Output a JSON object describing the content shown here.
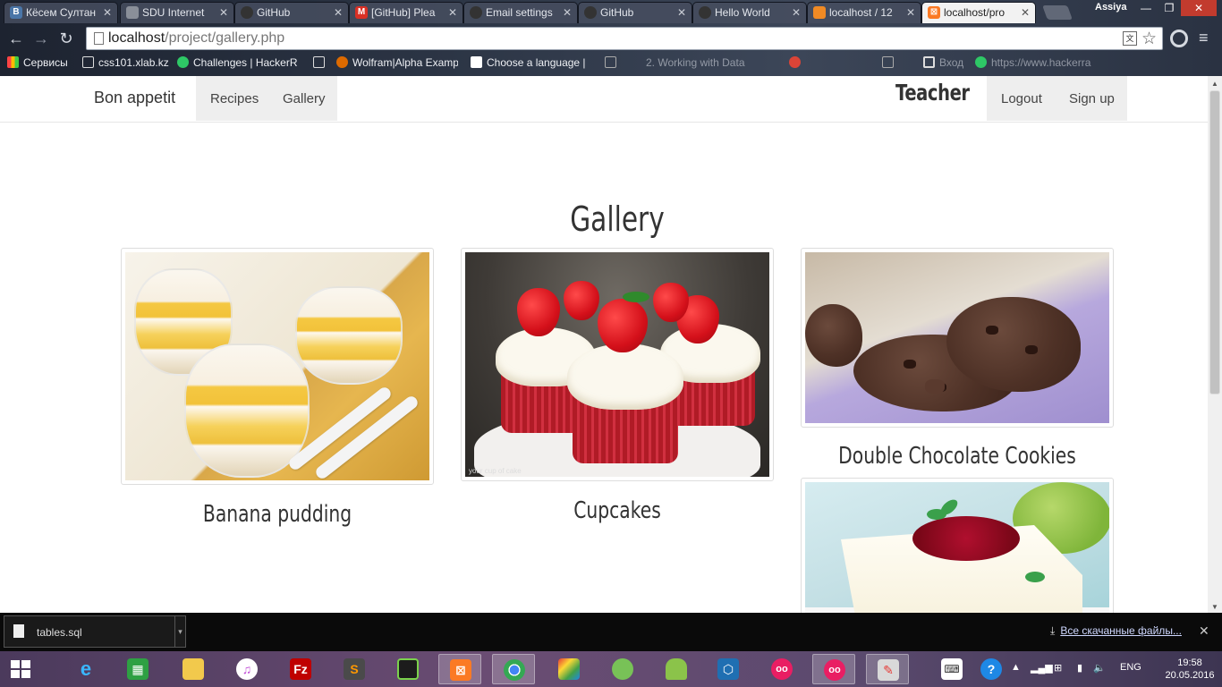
{
  "browser": {
    "tabs": [
      {
        "title": "Кёсем Султан",
        "favicon": "vk-icon",
        "color": "#4a76a8",
        "active": false
      },
      {
        "title": "SDU Internet",
        "favicon": "page-icon",
        "color": "#8a8f99",
        "active": false
      },
      {
        "title": "GitHub",
        "favicon": "github-icon",
        "color": "#333333",
        "active": false
      },
      {
        "title": "[GitHub] Plea",
        "favicon": "gmail-icon",
        "color": "#d93025",
        "active": false
      },
      {
        "title": "Email settings",
        "favicon": "github-icon",
        "color": "#333333",
        "active": false
      },
      {
        "title": "GitHub",
        "favicon": "github-icon",
        "color": "#333333",
        "active": false
      },
      {
        "title": "Hello World",
        "favicon": "github-icon",
        "color": "#333333",
        "active": false
      },
      {
        "title": "localhost / 12",
        "favicon": "phpmyadmin-icon",
        "color": "#f08a24",
        "active": false
      },
      {
        "title": "localhost/pro",
        "favicon": "xampp-icon",
        "color": "#fb7a24",
        "active": true
      }
    ],
    "profile_name": "Assiya",
    "url_host": "localhost",
    "url_path": "/project/gallery.php",
    "bookmarks": [
      {
        "label": "Сервисы",
        "icon": "apps-icon",
        "color": "#f4b400"
      },
      {
        "label": "css101.xlab.kz",
        "icon": "page-icon",
        "color": "#ffffff"
      },
      {
        "label": "Challenges | HackerR",
        "icon": "hackerrank-icon",
        "color": "#2ec866"
      },
      {
        "label": "",
        "icon": "page-icon",
        "color": "#ffffff"
      },
      {
        "label": "Wolfram|Alpha Examp",
        "icon": "wolfram-icon",
        "color": "#dd6a00"
      },
      {
        "label": "Choose a language |",
        "icon": "codeacademy-icon",
        "color": "#ffffff"
      },
      {
        "label": "",
        "icon": "page-icon",
        "color": "#ffffff"
      },
      {
        "label": "2. Working with Data",
        "icon": "",
        "color": ""
      },
      {
        "label": "",
        "icon": "chrome-icon",
        "color": "#db4437"
      },
      {
        "label": "",
        "icon": "page-icon",
        "color": "#ffffff"
      },
      {
        "label": "Вход",
        "icon": "grid-icon",
        "color": "#ffffff"
      },
      {
        "label": "https://www.hackerra",
        "icon": "hackerrank-icon",
        "color": "#2ec866"
      }
    ]
  },
  "site": {
    "brand": "Bon appetit",
    "nav_left": [
      "Recipes",
      "Gallery"
    ],
    "user_label": "Teacher",
    "nav_right": [
      "Logout",
      "Sign up"
    ],
    "page_title": "Gallery",
    "gallery": [
      {
        "caption": "Banana pudding",
        "image": "banana-pudding-image"
      },
      {
        "caption": "Cupcakes",
        "image": "cupcakes-image"
      },
      {
        "caption": "Double Chocolate Cookies",
        "image": "chocolate-cookies-image"
      },
      {
        "caption": "",
        "image": "cheesecake-image"
      }
    ]
  },
  "downloads": {
    "file_name": "tables.sql",
    "show_all_label": "Все скачанные файлы..."
  },
  "taskbar": {
    "apps": [
      "ie-icon",
      "store-icon",
      "explorer-icon",
      "itunes-icon",
      "filezilla-icon",
      "sublime-icon",
      "console-icon",
      "xampp-icon",
      "chrome-icon",
      "paint-icon",
      "android-studio-icon",
      "android-icon",
      "virtualbox-icon",
      "flickr-icon",
      "flickr-icon",
      "paint-brush-icon",
      "keyboard-icon",
      "help-icon"
    ],
    "language": "ENG",
    "time": "19:58",
    "date": "20.05.2016"
  }
}
